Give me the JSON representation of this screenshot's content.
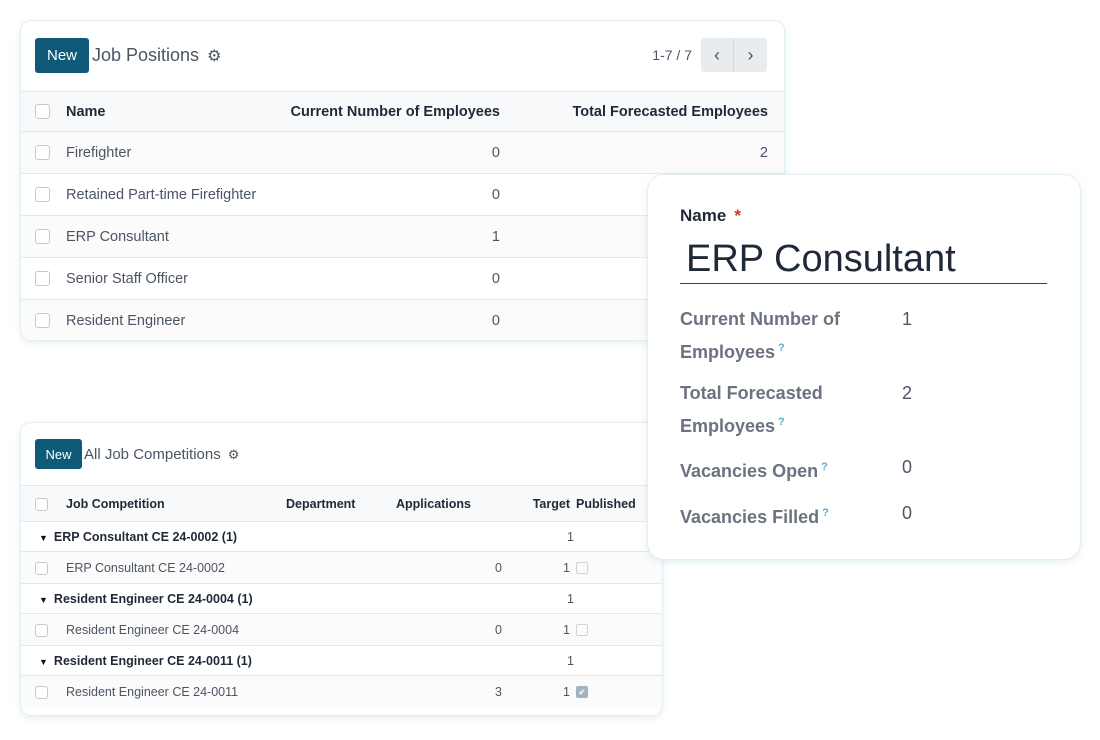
{
  "job_positions": {
    "new_label": "New",
    "title": "Job Positions",
    "gear_icon": "gear-icon",
    "pager": "1-7 / 7",
    "prev_icon": "‹",
    "next_icon": "›",
    "columns": [
      "Name",
      "Current Number of Employees",
      "Total Forecasted Employees"
    ],
    "rows": [
      {
        "name": "Firefighter",
        "current": "0",
        "forecast": "2"
      },
      {
        "name": "Retained Part-time Firefighter",
        "current": "0",
        "forecast": ""
      },
      {
        "name": "ERP Consultant",
        "current": "1",
        "forecast": ""
      },
      {
        "name": "Senior Staff Officer",
        "current": "0",
        "forecast": ""
      },
      {
        "name": "Resident Engineer",
        "current": "0",
        "forecast": ""
      }
    ]
  },
  "job_competitions": {
    "new_label": "New",
    "title": "All Job Competitions",
    "columns": [
      "Job Competition",
      "Department",
      "Applications",
      "Target",
      "Published"
    ],
    "groups": [
      {
        "label": "ERP Consultant CE 24-0002 (1)",
        "target": "1",
        "record": {
          "name": "ERP Consultant CE 24-0002",
          "department": "",
          "applications": "0",
          "target": "1",
          "published": false
        }
      },
      {
        "label": "Resident Engineer CE 24-0004 (1)",
        "target": "1",
        "record": {
          "name": "Resident Engineer CE 24-0004",
          "department": "",
          "applications": "0",
          "target": "1",
          "published": false
        }
      },
      {
        "label": "Resident Engineer CE 24-0011 (1)",
        "target": "1",
        "record": {
          "name": "Resident Engineer CE 24-0011",
          "department": "",
          "applications": "3",
          "target": "1",
          "published": true
        }
      }
    ]
  },
  "form": {
    "name_label": "Name",
    "required_mark": "*",
    "name_value": "ERP Consultant",
    "help_mark": "?",
    "fields": [
      {
        "label": "Current Number of Employees",
        "value": "1"
      },
      {
        "label": "Total Forecasted Employees",
        "value": "2"
      },
      {
        "label": "Vacancies Open",
        "value": "0"
      },
      {
        "label": "Vacancies Filled",
        "value": "0"
      }
    ]
  },
  "colors": {
    "primary": "#0f5a78",
    "required": "#c0392b",
    "help": "#5aaecb"
  }
}
